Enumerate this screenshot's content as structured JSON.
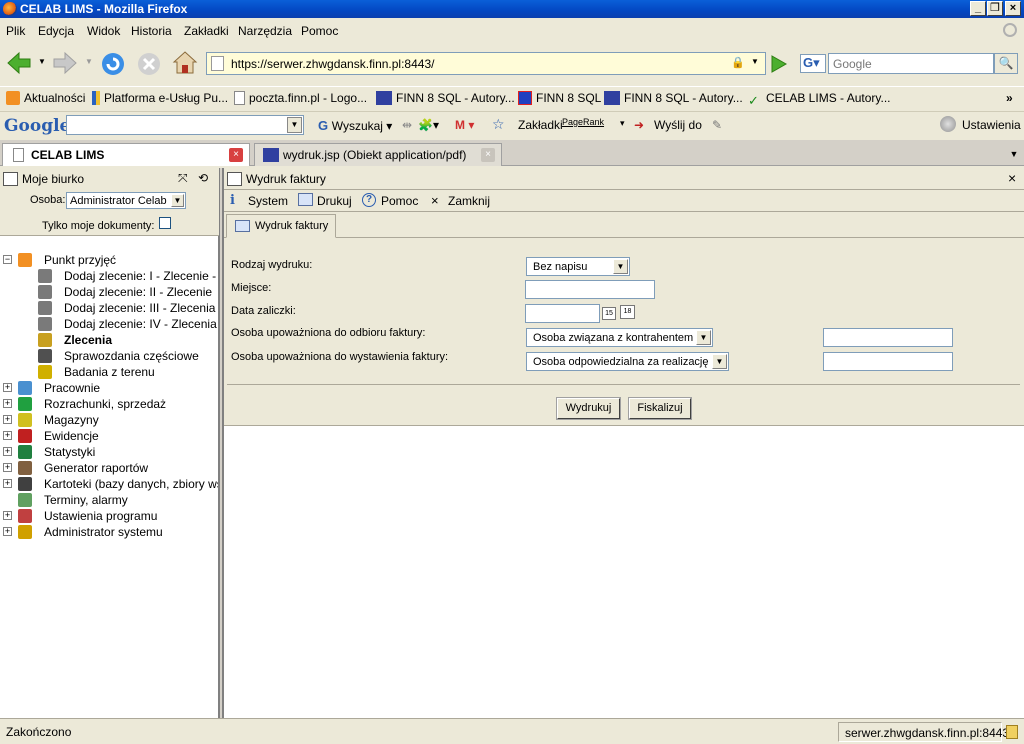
{
  "window": {
    "title": "CELAB LIMS - Mozilla Firefox"
  },
  "menu": [
    "Plik",
    "Edycja",
    "Widok",
    "Historia",
    "Zakładki",
    "Narzędzia",
    "Pomoc"
  ],
  "nav": {
    "url": "https://serwer.zhwgdansk.finn.pl:8443/",
    "search_placeholder": "Google"
  },
  "bookmarks": [
    "Aktualności",
    "Platforma e-Usług Pu...",
    "poczta.finn.pl - Logo...",
    "FINN 8 SQL - Autory...",
    "FINN 8 SQL",
    "FINN 8 SQL - Autory...",
    "CELAB LIMS - Autory..."
  ],
  "google_toolbar": {
    "logo": "Google",
    "search": "Wyszukaj",
    "bookmarks": "Zakładki",
    "pagerank": "PageRank",
    "send": "Wyślij do",
    "settings": "Ustawienia"
  },
  "tabs": [
    {
      "label": "CELAB LIMS"
    },
    {
      "label": "wydruk.jsp (Obiekt application/pdf)"
    }
  ],
  "left": {
    "title": "Moje biurko",
    "person_label": "Osoba:",
    "person_value": "Administrator Celab",
    "only_mine_label": "Tylko moje dokumenty:",
    "tree": [
      {
        "label": "Punkt przyjęć",
        "level": 0,
        "expanded": true
      },
      {
        "label": "Dodaj zlecenie: I - Zlecenie -",
        "level": 1
      },
      {
        "label": "Dodaj zlecenie: II - Zlecenie",
        "level": 1
      },
      {
        "label": "Dodaj zlecenie: III - Zlecenia",
        "level": 1
      },
      {
        "label": "Dodaj zlecenie: IV - Zlecenia",
        "level": 1
      },
      {
        "label": "Zlecenia",
        "level": 1,
        "bold": true
      },
      {
        "label": "Sprawozdania częściowe",
        "level": 1
      },
      {
        "label": "Badania z terenu",
        "level": 1
      },
      {
        "label": "Pracownie",
        "level": 0
      },
      {
        "label": "Rozrachunki, sprzedaż",
        "level": 0
      },
      {
        "label": "Magazyny",
        "level": 0
      },
      {
        "label": "Ewidencje",
        "level": 0
      },
      {
        "label": "Statystyki",
        "level": 0
      },
      {
        "label": "Generator raportów",
        "level": 0
      },
      {
        "label": "Kartoteki (bazy danych, zbiory ws",
        "level": 0
      },
      {
        "label": "Terminy, alarmy",
        "level": 0,
        "noexp": true
      },
      {
        "label": "Ustawienia programu",
        "level": 0
      },
      {
        "label": "Administrator systemu",
        "level": 0
      }
    ]
  },
  "right": {
    "title": "Wydruk faktury",
    "toolbar": {
      "system": "System",
      "print": "Drukuj",
      "help": "Pomoc",
      "close": "Zamknij"
    },
    "tab": "Wydruk faktury",
    "form": {
      "type_label": "Rodzaj wydruku:",
      "type_value": "Bez napisu",
      "place_label": "Miejsce:",
      "date_label": "Data zaliczki:",
      "receiver_label": "Osoba upoważniona do odbioru faktury:",
      "receiver_value": "Osoba związana z kontrahentem",
      "issuer_label": "Osoba upoważniona do wystawienia faktury:",
      "issuer_value": "Osoba odpowiedzialna za realizację",
      "print_button": "Wydrukuj",
      "fiscal_button": "Fiskalizuj"
    }
  },
  "status": {
    "left": "Zakończono",
    "right": "serwer.zhwgdansk.finn.pl:8443"
  }
}
